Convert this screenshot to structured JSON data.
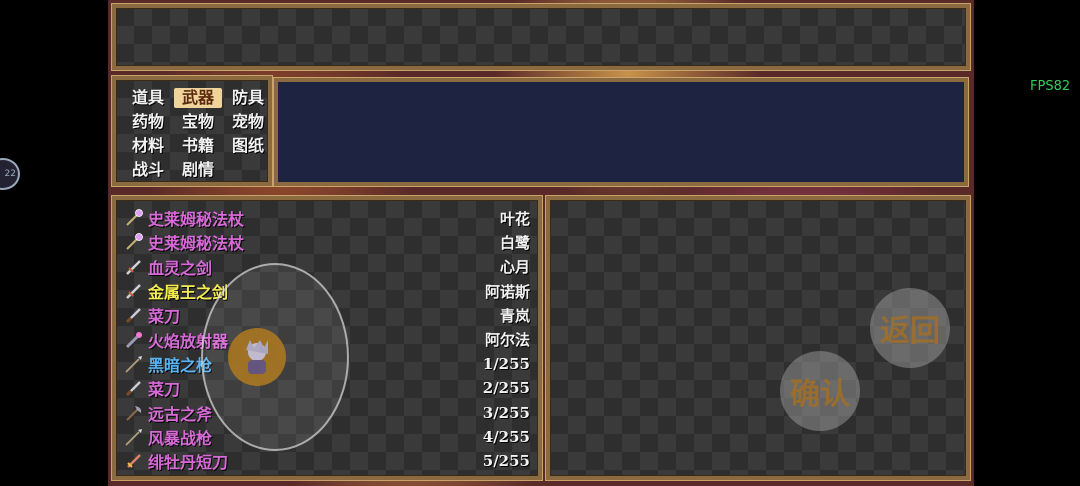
{
  "fps": "FPS82",
  "side_badge": "22",
  "categories": [
    {
      "label": "道具",
      "active": false
    },
    {
      "label": "武器",
      "active": true
    },
    {
      "label": "防具",
      "active": false
    },
    {
      "label": "药物",
      "active": false
    },
    {
      "label": "宝物",
      "active": false
    },
    {
      "label": "宠物",
      "active": false
    },
    {
      "label": "材料",
      "active": false
    },
    {
      "label": "书籍",
      "active": false
    },
    {
      "label": "图纸",
      "active": false
    },
    {
      "label": "战斗",
      "active": false
    },
    {
      "label": "剧情",
      "active": false
    }
  ],
  "items": [
    {
      "name": "史莱姆秘法杖",
      "owner": "叶花",
      "color": "#d86ad8",
      "icon": "staff-icon"
    },
    {
      "name": "史莱姆秘法杖",
      "owner": "白鹭",
      "color": "#d86ad8",
      "icon": "staff-icon"
    },
    {
      "name": "血灵之剑",
      "owner": "心月",
      "color": "#d86ad8",
      "icon": "sword-icon"
    },
    {
      "name": "金属王之剑",
      "owner": "阿诺斯",
      "color": "#f5ec52",
      "icon": "sword-icon"
    },
    {
      "name": "菜刀",
      "owner": "青岚",
      "color": "#d86ad8",
      "icon": "knife-icon"
    },
    {
      "name": "火焰放射器",
      "owner": "阿尔法",
      "color": "#d86ad8",
      "icon": "flamethrower-icon"
    },
    {
      "name": "黑暗之枪",
      "owner": "1/255",
      "color": "#5ab4f0",
      "icon": "spear-icon"
    },
    {
      "name": "菜刀",
      "owner": "2/255",
      "color": "#d86ad8",
      "icon": "knife-icon"
    },
    {
      "name": "远古之斧",
      "owner": "3/255",
      "color": "#d86ad8",
      "icon": "axe-icon"
    },
    {
      "name": "风暴战枪",
      "owner": "4/255",
      "color": "#d86ad8",
      "icon": "spear-icon"
    },
    {
      "name": "绯牡丹短刀",
      "owner": "5/255",
      "color": "#d86ad8",
      "icon": "dagger-icon"
    }
  ],
  "buttons": {
    "back": "返回",
    "confirm": "确认"
  }
}
